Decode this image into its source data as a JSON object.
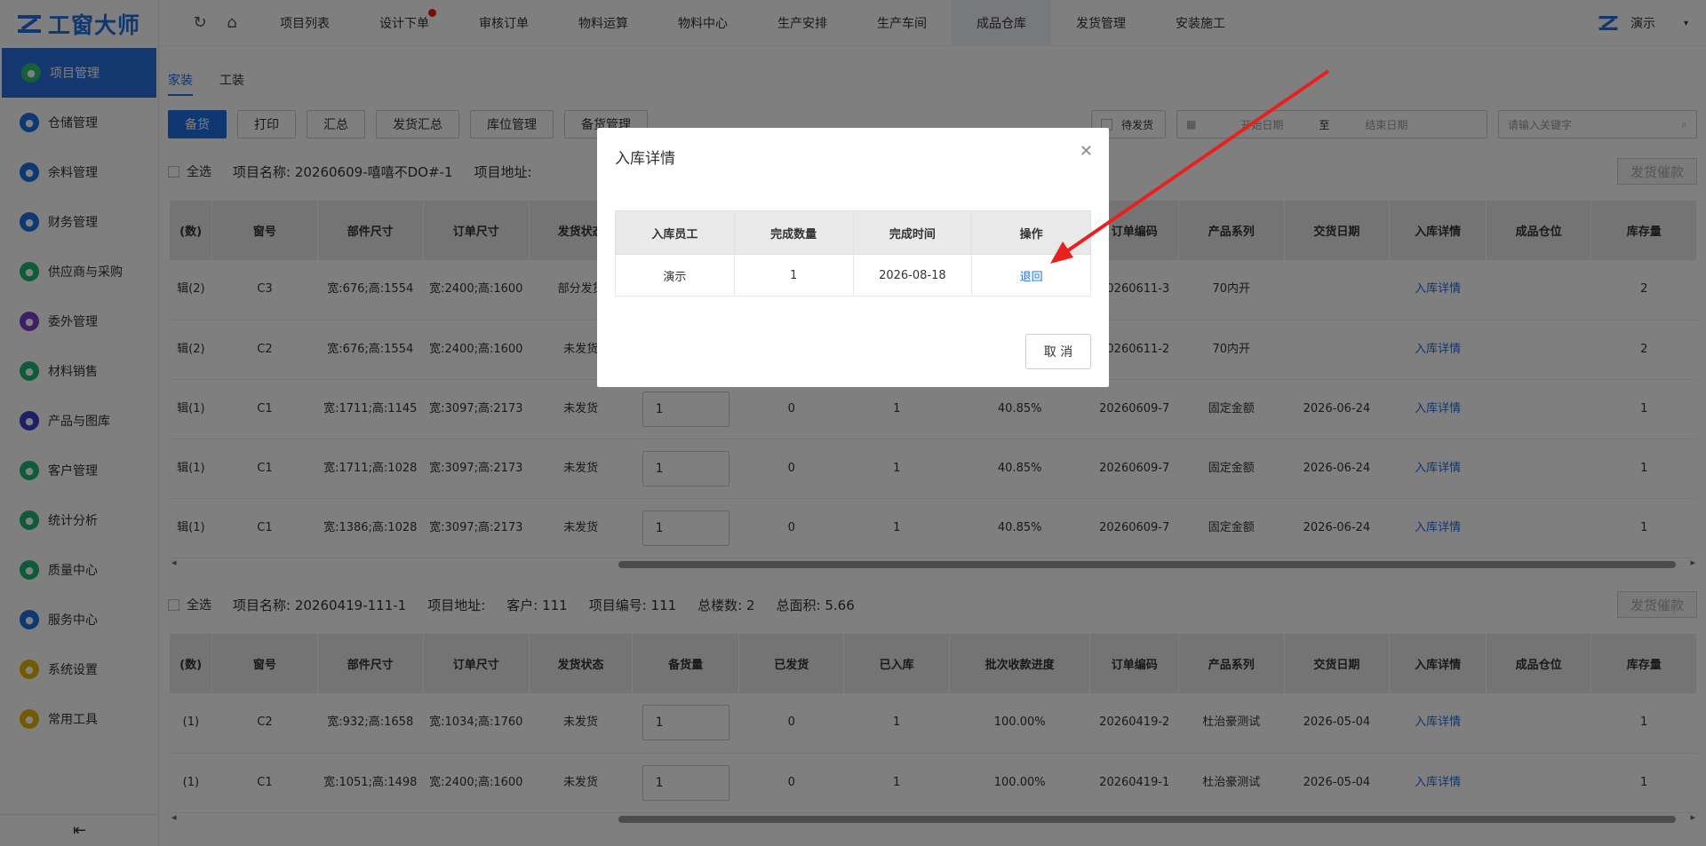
{
  "app": {
    "logo_text": "工窗大师"
  },
  "sidebar": {
    "items": [
      {
        "label": "项目管理",
        "icon": "project-icon",
        "color": "#22b573",
        "active": true
      },
      {
        "label": "仓储管理",
        "icon": "warehouse-icon",
        "color": "#1f6fe5"
      },
      {
        "label": "余料管理",
        "icon": "leftover-icon",
        "color": "#1f6fe5"
      },
      {
        "label": "财务管理",
        "icon": "finance-icon",
        "color": "#1f6fe5"
      },
      {
        "label": "供应商与采购",
        "icon": "supplier-icon",
        "color": "#22b573"
      },
      {
        "label": "委外管理",
        "icon": "outsource-icon",
        "color": "#7b3fd0"
      },
      {
        "label": "材料销售",
        "icon": "material-sales-icon",
        "color": "#22b573"
      },
      {
        "label": "产品与图库",
        "icon": "product-icon",
        "color": "#3b3fd0"
      },
      {
        "label": "客户管理",
        "icon": "customer-icon",
        "color": "#22b573"
      },
      {
        "label": "统计分析",
        "icon": "stats-icon",
        "color": "#22b573"
      },
      {
        "label": "质量中心",
        "icon": "quality-icon",
        "color": "#22b573"
      },
      {
        "label": "服务中心",
        "icon": "service-icon",
        "color": "#1f6fe5"
      },
      {
        "label": "系统设置",
        "icon": "settings-icon",
        "color": "#e5b400"
      },
      {
        "label": "常用工具",
        "icon": "tools-icon",
        "color": "#e5b400"
      }
    ],
    "collapse_icon": "collapse-icon"
  },
  "topnav": {
    "tabs": [
      {
        "label": "项目列表"
      },
      {
        "label": "设计下单",
        "badge": true
      },
      {
        "label": "审核订单"
      },
      {
        "label": "物料运算"
      },
      {
        "label": "物料中心"
      },
      {
        "label": "生产安排"
      },
      {
        "label": "生产车间"
      },
      {
        "label": "成品仓库",
        "active": true
      },
      {
        "label": "发货管理"
      },
      {
        "label": "安装施工"
      }
    ],
    "user": "演示"
  },
  "subtabs": [
    "家装",
    "工装"
  ],
  "toolbar": {
    "buttons": [
      "备货",
      "打印",
      "汇总",
      "发货汇总",
      "库位管理",
      "备货管理"
    ],
    "filter_pending": "待发货",
    "start_date": "开始日期",
    "to": "至",
    "end_date": "结束日期",
    "search_placeholder": "请输入关键字"
  },
  "columns": [
    "(数)",
    "窗号",
    "部件尺寸",
    "订单尺寸",
    "发货状态",
    "备货量",
    "已发货",
    "已入库",
    "批次收款进度",
    "订单编码",
    "产品系列",
    "交货日期",
    "入库详情",
    "成品仓位",
    "库存量"
  ],
  "project1": {
    "select_all": "全选",
    "name_label": "项目名称:",
    "name": "20260609-嘻嘻不DO#-1",
    "address_label": "项目地址:",
    "pay_button": "发货催款",
    "rows": [
      [
        "辑(2)",
        "C3",
        "宽:676;高:1554",
        "宽:2400;高:1600",
        "部分发货",
        "",
        "",
        "",
        "",
        "20260611-3",
        "70内开",
        "",
        "入库详情",
        "",
        "2"
      ],
      [
        "辑(2)",
        "C2",
        "宽:676;高:1554",
        "宽:2400;高:1600",
        "未发货",
        "",
        "",
        "",
        "",
        "20260611-2",
        "70内开",
        "",
        "入库详情",
        "",
        "2"
      ],
      [
        "辑(1)",
        "C1",
        "宽:1711;高:1145",
        "宽:3097;高:2173",
        "未发货",
        "1",
        "0",
        "1",
        "40.85%",
        "20260609-7",
        "固定金额",
        "2026-06-24",
        "入库详情",
        "",
        "1"
      ],
      [
        "辑(1)",
        "C1",
        "宽:1711;高:1028",
        "宽:3097;高:2173",
        "未发货",
        "1",
        "0",
        "1",
        "40.85%",
        "20260609-7",
        "固定金额",
        "2026-06-24",
        "入库详情",
        "",
        "1"
      ],
      [
        "辑(1)",
        "C1",
        "宽:1386;高:1028",
        "宽:3097;高:2173",
        "未发货",
        "1",
        "0",
        "1",
        "40.85%",
        "20260609-7",
        "固定金额",
        "2026-06-24",
        "入库详情",
        "",
        "1"
      ]
    ]
  },
  "project2": {
    "select_all": "全选",
    "name_label": "项目名称:",
    "name": "20260419-111-1",
    "address_label": "项目地址:",
    "customer": "客户: 111",
    "code": "项目编号: 111",
    "floors": "总楼数: 2",
    "area": "总面积: 5.66",
    "pay_button": "发货催款",
    "rows": [
      [
        "(1)",
        "C2",
        "宽:932;高:1658",
        "宽:1034;高:1760",
        "未发货",
        "1",
        "0",
        "1",
        "100.00%",
        "20260419-2",
        "杜治豪测试",
        "2026-05-04",
        "入库详情",
        "",
        "1"
      ],
      [
        "(1)",
        "C1",
        "宽:1051;高:1498",
        "宽:2400;高:1600",
        "未发货",
        "1",
        "0",
        "1",
        "100.00%",
        "20260419-1",
        "杜治豪测试",
        "2026-05-04",
        "入库详情",
        "",
        "1"
      ]
    ]
  },
  "modal": {
    "title": "入库详情",
    "headers": [
      "入库员工",
      "完成数量",
      "完成时间",
      "操作"
    ],
    "row": {
      "employee": "演示",
      "qty": "1",
      "time": "2026-08-18",
      "action": "退回"
    },
    "cancel": "取 消"
  },
  "annotation_color": "#e8211e"
}
